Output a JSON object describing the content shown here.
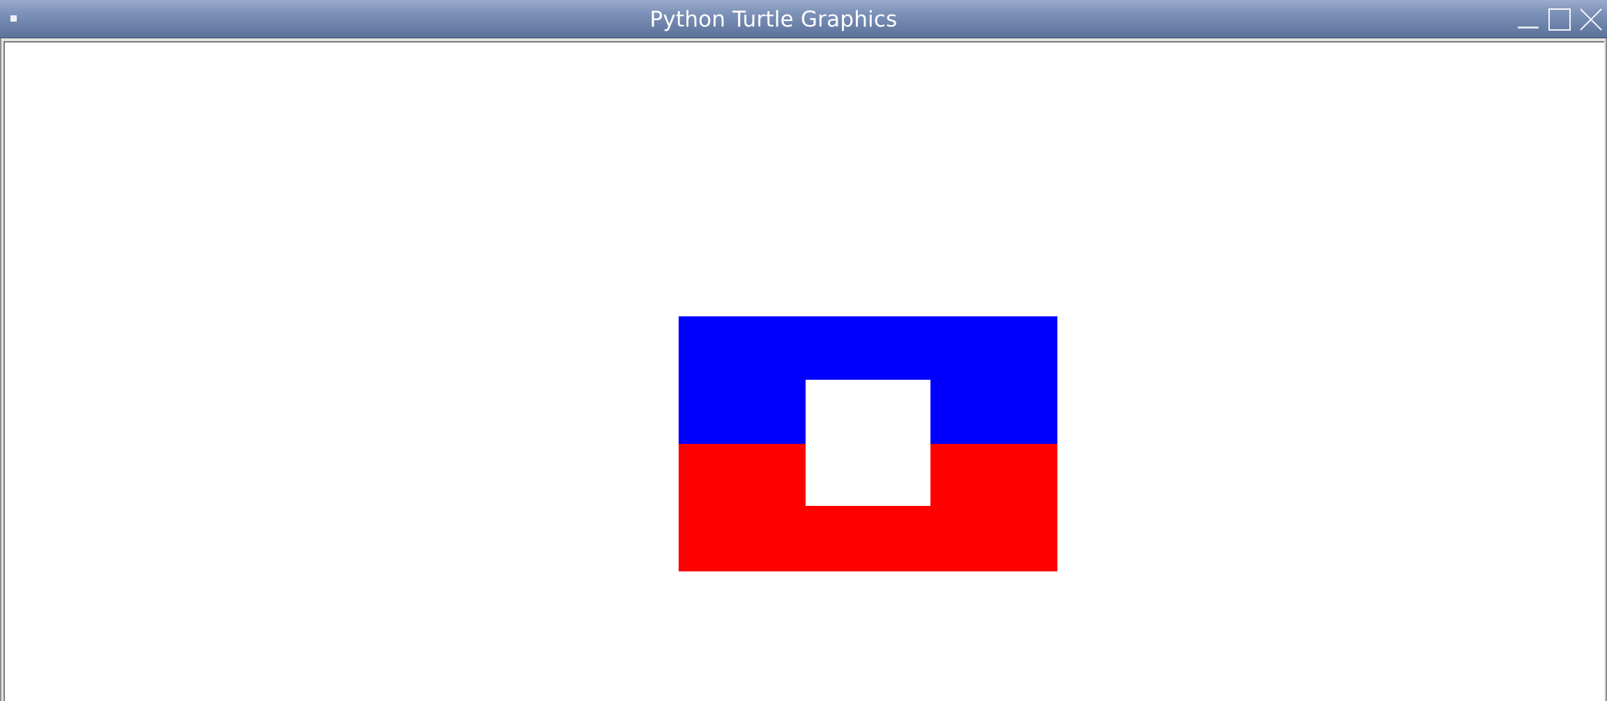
{
  "window": {
    "title": "Python Turtle Graphics",
    "controls": {
      "menu": "window-menu-icon",
      "minimize": "minimize-icon",
      "maximize": "maximize-icon",
      "close": "close-icon"
    }
  },
  "drawing": {
    "background": "#ffffff",
    "shapes": [
      {
        "name": "blue-rectangle",
        "color": "#0000ff"
      },
      {
        "name": "red-rectangle",
        "color": "#ff0000"
      },
      {
        "name": "white-square",
        "color": "#ffffff"
      }
    ]
  }
}
